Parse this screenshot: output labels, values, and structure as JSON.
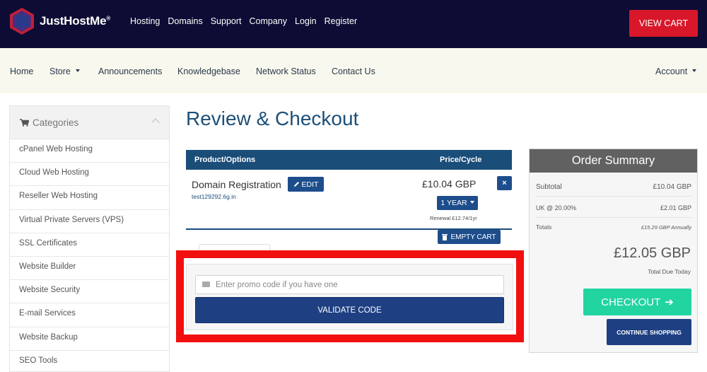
{
  "header": {
    "brand": "JustHostMe",
    "brand_mark": "®",
    "nav": [
      "Hosting",
      "Domains",
      "Support",
      "Company",
      "Login",
      "Register"
    ],
    "view_cart_label": "VIEW CART"
  },
  "subnav": {
    "home": "Home",
    "store": "Store",
    "announcements": "Announcements",
    "knowledgebase": "Knowledgebase",
    "network_status": "Network Status",
    "contact_us": "Contact Us",
    "account": "Account"
  },
  "sidebar": {
    "title": "Categories",
    "items": [
      "cPanel Web Hosting",
      "Cloud Web Hosting",
      "Reseller Web Hosting",
      "Virtual Private Servers (VPS)",
      "SSL Certificates",
      "Website Builder",
      "Website Security",
      "E-mail Services",
      "Website Backup",
      "SEO Tools"
    ]
  },
  "main": {
    "title": "Review & Checkout",
    "table": {
      "col_product": "Product/Options",
      "col_price": "Price/Cycle"
    },
    "item": {
      "name": "Domain Registration",
      "edit_label": "EDIT",
      "domain": "test129292.6g.in",
      "price": "£10.04 GBP",
      "cycle_label": "1 YEAR",
      "renewal": "Renewal £12.74/1yr",
      "remove_icon": "×"
    },
    "empty_cart_label": "EMPTY CART",
    "promo": {
      "placeholder": "Enter promo code if you have one",
      "validate_label": "VALIDATE CODE"
    }
  },
  "summary": {
    "title": "Order Summary",
    "subtotal_label": "Subtotal",
    "subtotal_value": "£10.04 GBP",
    "tax_label": "UK @ 20.00%",
    "tax_value": "£2.01 GBP",
    "totals_label": "Totals",
    "totals_value": "£15.29 GBP Annually",
    "total_due": "£12.05 GBP",
    "total_due_label": "Total Due Today",
    "checkout_label": "CHECKOUT",
    "checkout_arrow": "➔",
    "continue_label": "CONTINUE SHOPPING"
  },
  "colors": {
    "topbar": "#0c0c34",
    "accent_red": "#d8182a",
    "primary_blue": "#1e4083",
    "checkout_green": "#22d4a0",
    "highlight": "#f10f0f"
  }
}
